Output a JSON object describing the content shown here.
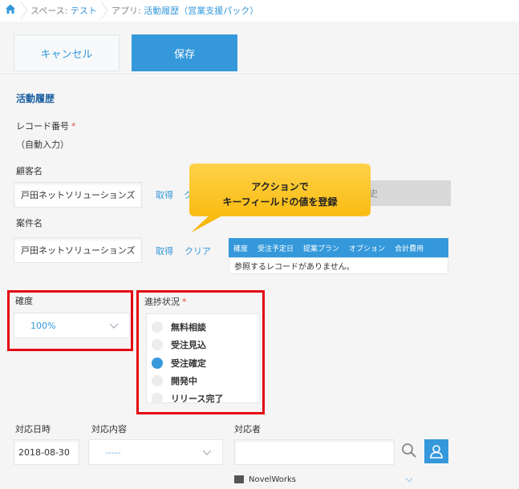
{
  "breadcrumb": {
    "space_label": "スペース: ",
    "space_name": "テスト",
    "app_label": "アプリ: ",
    "app_name": "活動履歴（営業支援パック）"
  },
  "toolbar": {
    "cancel_label": "キャンセル",
    "save_label": "保存"
  },
  "form": {
    "group_title": "活動履歴",
    "record_no": {
      "label": "レコード番号",
      "required_mark": "*",
      "value": "（自動入力）"
    },
    "customer": {
      "label": "顧客名",
      "value": "戸田ネットソリューションズ",
      "fetch": "取得",
      "clear": "ク",
      "right_text": "史"
    },
    "case": {
      "label": "案件名",
      "value": "戸田ネットソリューションズ",
      "fetch": "取得",
      "clear": "クリア",
      "ref_columns": [
        "確度",
        "受注予定日",
        "提案プラン",
        "オプション",
        "合計費用"
      ],
      "ref_empty": "参照するレコードがありません。"
    },
    "certainty": {
      "label": "確度",
      "value": "100%"
    },
    "progress": {
      "label": "進捗状況",
      "required_mark": "*",
      "options": [
        "無料相談",
        "受注見込",
        "受注確定",
        "開発中",
        "リリース完了"
      ],
      "selected": "受注確定"
    },
    "date": {
      "label": "対応日時",
      "value": "2018-08-30"
    },
    "content": {
      "label": "対応内容",
      "value": "-----"
    },
    "person": {
      "label": "対応者",
      "value": "",
      "user": "NovelWorks"
    }
  },
  "callout": {
    "line1": "アクションで",
    "line2": "キーフィールドの値を登録",
    "color": "#ffc000"
  },
  "colors": {
    "accent": "#3498db",
    "highlight": "#e30613",
    "group_title": "#1a5fa0"
  }
}
